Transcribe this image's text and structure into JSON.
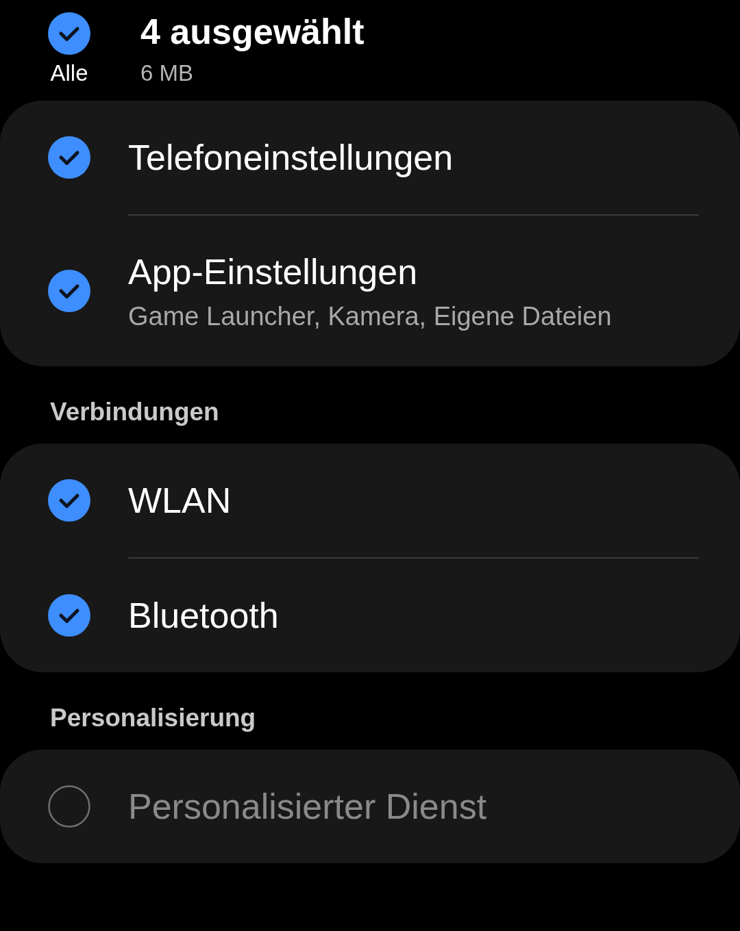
{
  "header": {
    "select_all": {
      "label": "Alle",
      "checked": true
    },
    "title": "4 ausgewählt",
    "size": "6 MB"
  },
  "groups": [
    {
      "items": [
        {
          "title": "Telefoneinstellungen",
          "checked": true,
          "disabled": false
        },
        {
          "title": "App-Einstellungen",
          "subtitle": "Game Launcher, Kamera, Eigene Dateien",
          "checked": true,
          "disabled": false
        }
      ]
    },
    {
      "title": "Verbindungen",
      "items": [
        {
          "title": "WLAN",
          "checked": true,
          "disabled": false
        },
        {
          "title": "Bluetooth",
          "checked": true,
          "disabled": false
        }
      ]
    },
    {
      "title": "Personalisierung",
      "items": [
        {
          "title": "Personalisierter Dienst",
          "checked": false,
          "disabled": true
        }
      ]
    }
  ]
}
